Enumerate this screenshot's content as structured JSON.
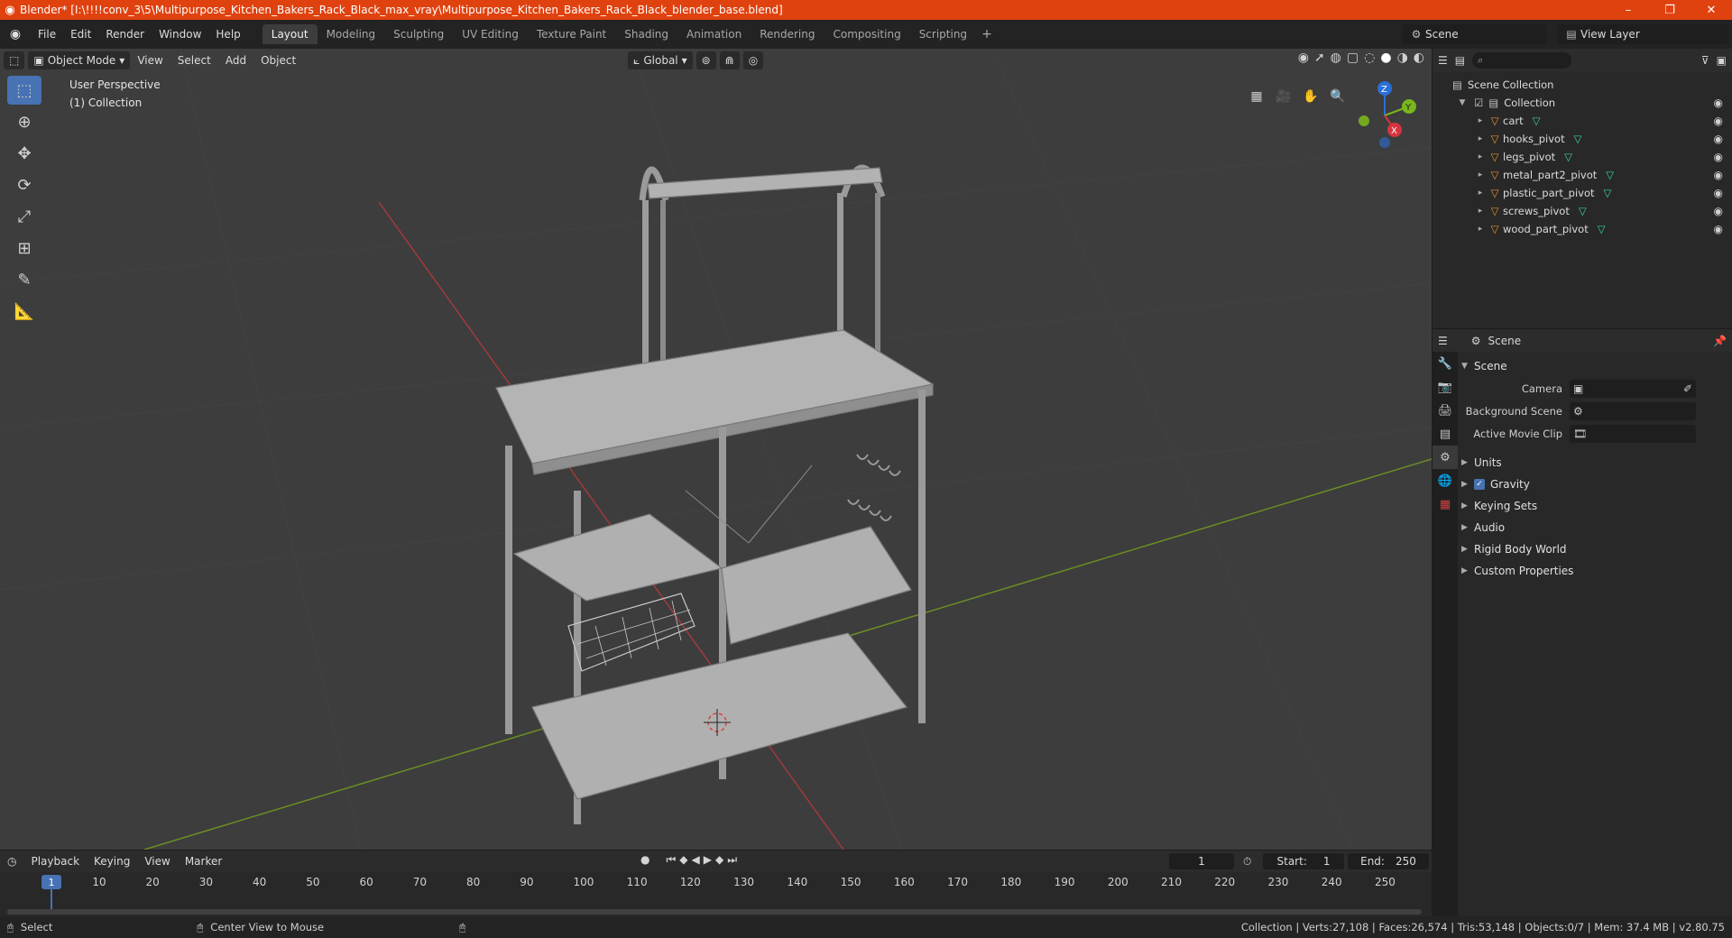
{
  "window": {
    "title": "Blender* [I:\\!!!!conv_3\\5\\Multipurpose_Kitchen_Bakers_Rack_Black_max_vray\\Multipurpose_Kitchen_Bakers_Rack_Black_blender_base.blend]",
    "minimize": "–",
    "maximize": "❐",
    "close": "✕"
  },
  "menu": [
    "File",
    "Edit",
    "Render",
    "Window",
    "Help"
  ],
  "workspaces": [
    {
      "label": "Layout",
      "active": true
    },
    {
      "label": "Modeling"
    },
    {
      "label": "Sculpting"
    },
    {
      "label": "UV Editing"
    },
    {
      "label": "Texture Paint"
    },
    {
      "label": "Shading"
    },
    {
      "label": "Animation"
    },
    {
      "label": "Rendering"
    },
    {
      "label": "Compositing"
    },
    {
      "label": "Scripting"
    }
  ],
  "workspace_add": "+",
  "scene_name": "Scene",
  "view_layer": "View Layer",
  "viewport": {
    "mode": "Object Mode",
    "menus": [
      "View",
      "Select",
      "Add",
      "Object"
    ],
    "transform": "Global",
    "info_line1": "User Perspective",
    "info_line2": "(1) Collection"
  },
  "gizmo": {
    "x": "X",
    "y": "Y",
    "z": "Z"
  },
  "outliner": {
    "root": "Scene Collection",
    "collection": "Collection",
    "objects": [
      "cart",
      "hooks_pivot",
      "legs_pivot",
      "metal_part2_pivot",
      "plastic_part_pivot",
      "screws_pivot",
      "wood_part_pivot"
    ]
  },
  "properties": {
    "header": "Scene",
    "section": "Scene",
    "fields": [
      {
        "label": "Camera"
      },
      {
        "label": "Background Scene"
      },
      {
        "label": "Active Movie Clip"
      }
    ],
    "subsections": [
      "Units",
      "Gravity",
      "Keying Sets",
      "Audio",
      "Rigid Body World",
      "Custom Properties"
    ]
  },
  "timeline": {
    "menus": [
      "Playback",
      "Keying",
      "View",
      "Marker"
    ],
    "current_frame": "1",
    "start_label": "Start:",
    "start": "1",
    "end_label": "End:",
    "end": "250",
    "ruler": [
      "1",
      "10",
      "20",
      "30",
      "40",
      "50",
      "60",
      "70",
      "80",
      "90",
      "100",
      "110",
      "120",
      "130",
      "140",
      "150",
      "160",
      "170",
      "180",
      "190",
      "200",
      "210",
      "220",
      "230",
      "240",
      "250"
    ]
  },
  "status": {
    "left": "Select",
    "middle": "Center View to Mouse",
    "right": "Collection | Verts:27,108 | Faces:26,574 | Tris:53,148 | Objects:0/7 | Mem: 37.4 MB | v2.80.75"
  },
  "colors": {
    "titlebar": "#e0420f",
    "accent": "#4772b3",
    "grid_x": "#a13a3a",
    "grid_y": "#6b8e23"
  }
}
